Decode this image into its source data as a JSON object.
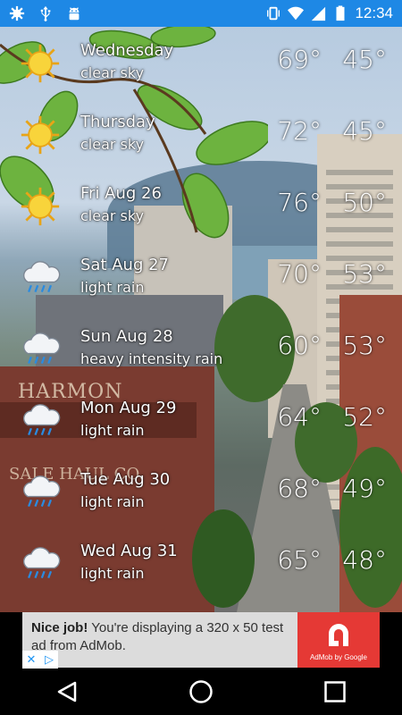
{
  "status_bar": {
    "time": "12:34",
    "left_icons": [
      "settings-icon",
      "usb-icon",
      "android-debug-icon"
    ],
    "right_icons": [
      "vibrate-icon",
      "wifi-icon",
      "signal-icon",
      "battery-icon"
    ]
  },
  "forecast": [
    {
      "day": "Wednesday",
      "description": "clear sky",
      "high": "69°",
      "low": "45°",
      "icon": "sun"
    },
    {
      "day": "Thursday",
      "description": "clear sky",
      "high": "72°",
      "low": "45°",
      "icon": "sun"
    },
    {
      "day": "Fri Aug 26",
      "description": "clear sky",
      "high": "76°",
      "low": "50°",
      "icon": "sun"
    },
    {
      "day": "Sat Aug 27",
      "description": "light rain",
      "high": "70°",
      "low": "53°",
      "icon": "rain"
    },
    {
      "day": "Sun Aug 28",
      "description": "heavy intensity rain",
      "high": "60°",
      "low": "53°",
      "icon": "rain"
    },
    {
      "day": "Mon Aug 29",
      "description": "light rain",
      "high": "64°",
      "low": "52°",
      "icon": "rain"
    },
    {
      "day": "Tue Aug 30",
      "description": "light rain",
      "high": "68°",
      "low": "49°",
      "icon": "rain"
    },
    {
      "day": "Wed Aug 31",
      "description": "light rain",
      "high": "65°",
      "low": "48°",
      "icon": "rain"
    }
  ],
  "ad": {
    "headline": "Nice job!",
    "body": "You're displaying a 320 x 50 test ad from AdMob.",
    "logo_label": "AdMob by Google"
  },
  "background_signs": {
    "sign1": "HARMON",
    "sign2": "SALE HAUL CO."
  },
  "nav": [
    "back-icon",
    "home-icon",
    "recents-icon"
  ]
}
